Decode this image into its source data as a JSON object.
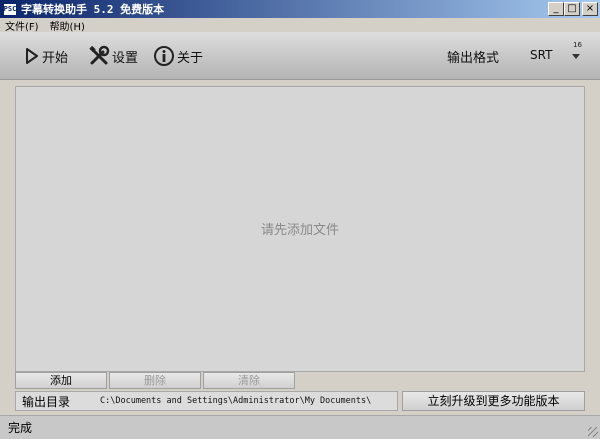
{
  "window": {
    "icon_text": "PSC",
    "title": "字幕转换助手 5.2 免费版本",
    "minimize": "_",
    "maximize": "□",
    "close": "×"
  },
  "menu": {
    "items": [
      {
        "label": "文件(F)"
      },
      {
        "label": "帮助(H)"
      }
    ]
  },
  "toolbar": {
    "start_label": "开始",
    "settings_label": "设置",
    "about_label": "关于",
    "format_label": "输出格式",
    "format_value": "SRT",
    "format_number": "16"
  },
  "filelist": {
    "placeholder": "请先添加文件"
  },
  "actions": {
    "add_label": "添加",
    "delete_label": "删除",
    "clear_label": "清除"
  },
  "output": {
    "label": "输出目录",
    "path": "C:\\Documents and Settings\\Administrator\\My Documents\\",
    "upgrade_label": "立刻升级到更多功能版本"
  },
  "status": {
    "text": "完成"
  },
  "colors": {
    "titlebar_start": "#0a246a",
    "titlebar_end": "#a6caf0",
    "disabled_text": "#9a9a9a",
    "placeholder_text": "#8a8a8a"
  }
}
